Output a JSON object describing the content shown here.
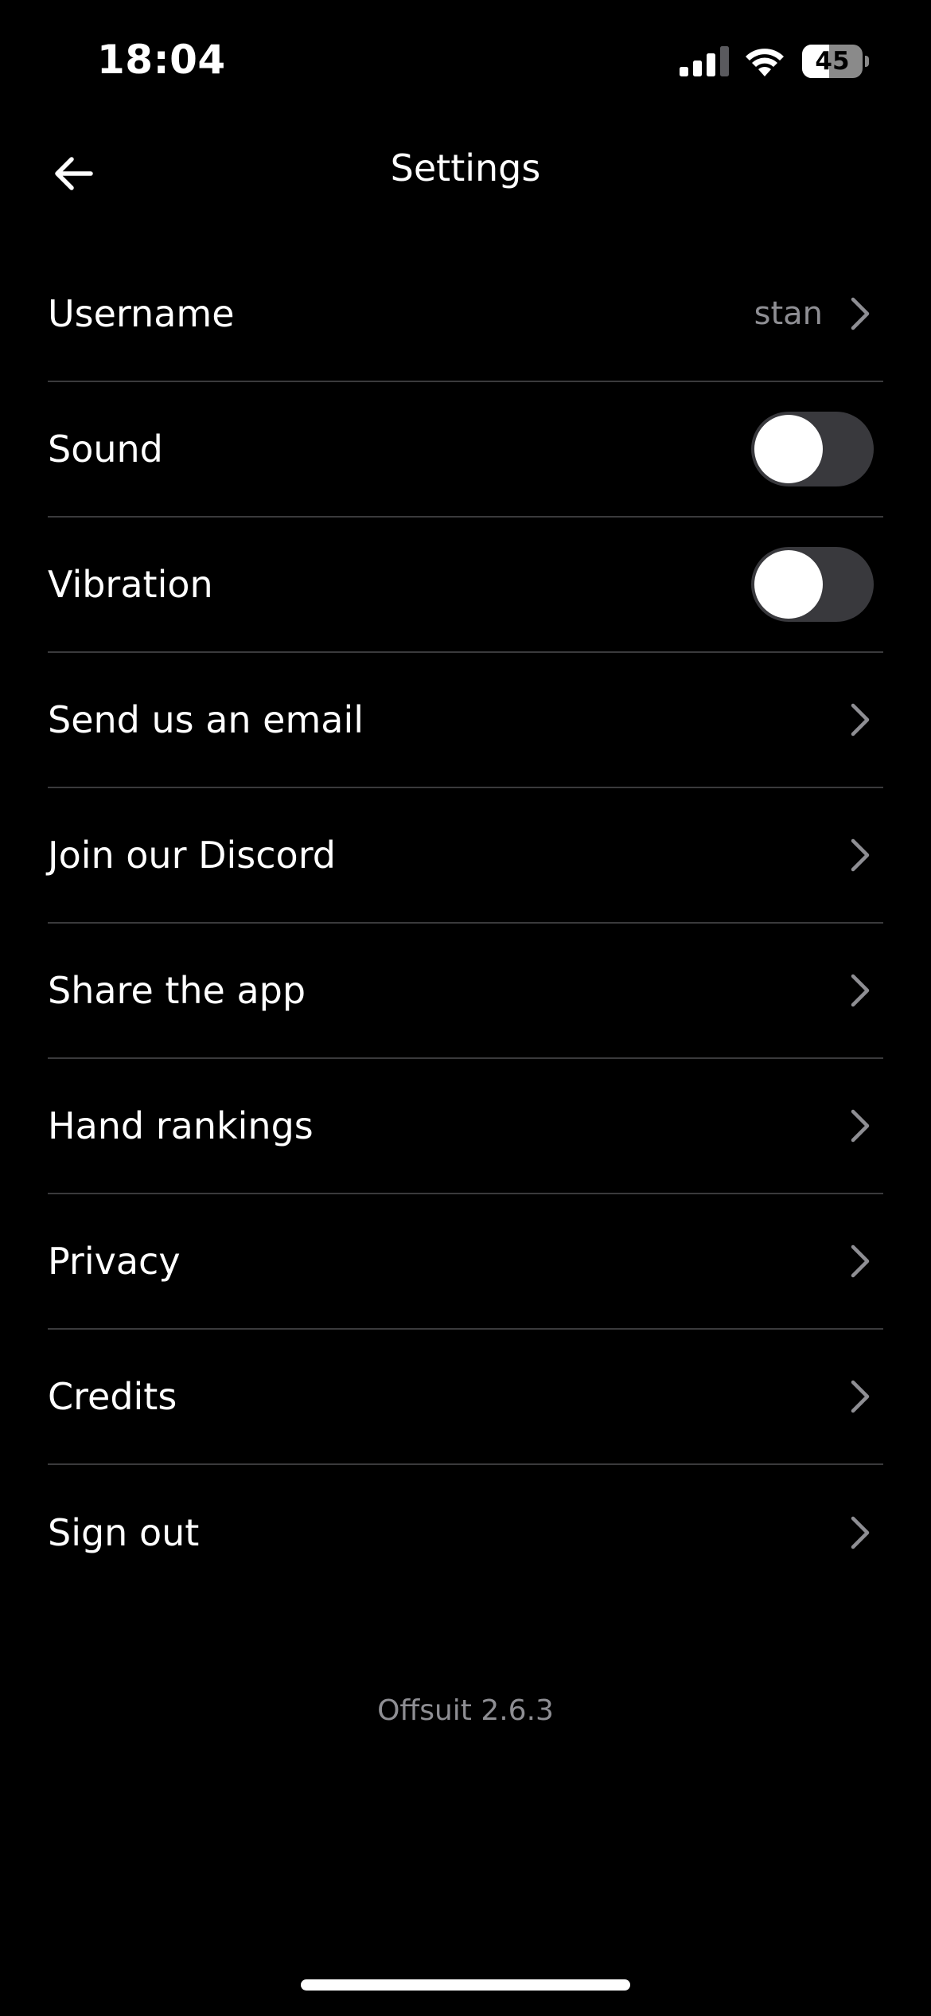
{
  "status_bar": {
    "time": "18:04",
    "battery_level": "45",
    "battery_fraction": 0.45
  },
  "header": {
    "title": "Settings",
    "back_icon": "arrow-left-icon"
  },
  "settings": [
    {
      "label": "Username",
      "value": "stan",
      "type": "link"
    },
    {
      "label": "Sound",
      "type": "toggle",
      "on": false
    },
    {
      "label": "Vibration",
      "type": "toggle",
      "on": false
    },
    {
      "label": "Send us an email",
      "type": "link"
    },
    {
      "label": "Join our Discord",
      "type": "link"
    },
    {
      "label": "Share the app",
      "type": "link"
    },
    {
      "label": "Hand rankings",
      "type": "link"
    },
    {
      "label": "Privacy",
      "type": "link"
    },
    {
      "label": "Credits",
      "type": "link"
    },
    {
      "label": "Sign out",
      "type": "link"
    }
  ],
  "footer": {
    "version": "Offsuit 2.6.3"
  },
  "colors": {
    "background": "#000000",
    "separator": "#3a3a3c",
    "secondary_text": "#8e8e93",
    "toggle_off": "#39393d"
  }
}
